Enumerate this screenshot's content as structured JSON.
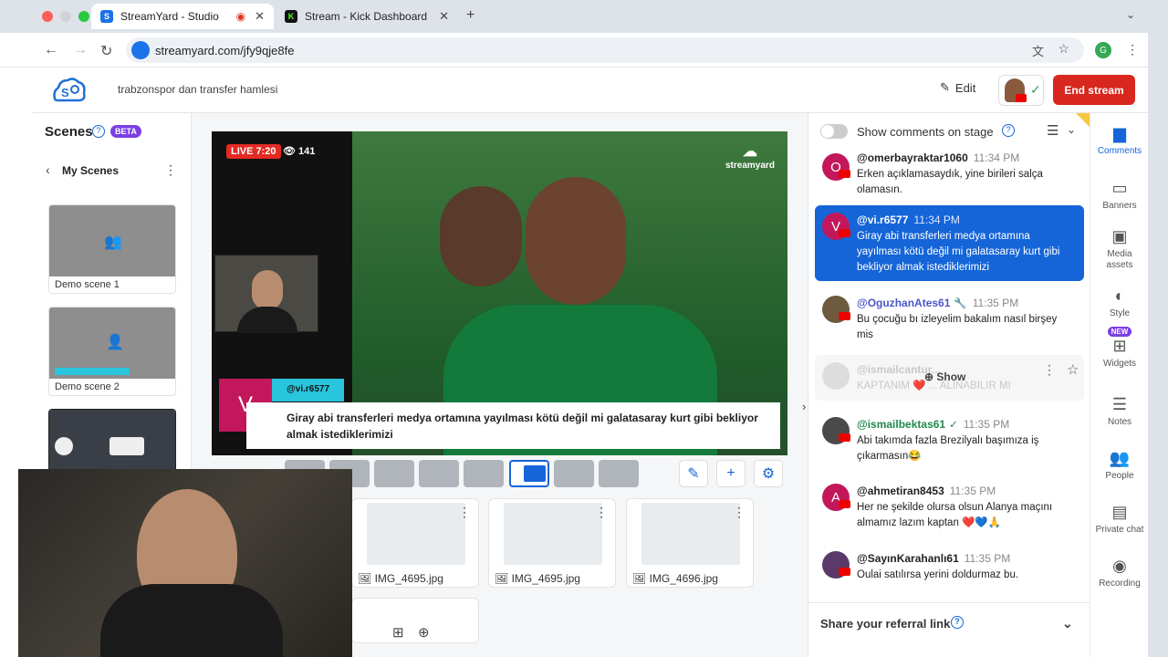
{
  "browser": {
    "tabs": [
      {
        "title": "StreamYard - Studio",
        "active": true
      },
      {
        "title": "Stream - Kick Dashboard",
        "active": false
      }
    ],
    "url": "streamyard.com/jfy9qje8fe",
    "profile_initial": "G"
  },
  "header": {
    "broadcast_title": "trabzonspor dan transfer hamlesi",
    "edit_label": "Edit",
    "end_stream_label": "End stream"
  },
  "scenes": {
    "title": "Scenes",
    "beta": "BETA",
    "my_scenes": "My Scenes",
    "items": [
      {
        "label": "Demo scene 1"
      },
      {
        "label": "Demo scene 2"
      }
    ]
  },
  "stage": {
    "live_label": "LIVE 7:20",
    "viewers": "141",
    "watermark": "streamyard",
    "banner": {
      "avatar_initial": "V",
      "user": "@vi.r6577",
      "text": "Giray abi transferleri medya ortamına yayılması kötü değil mi galatasaray kurt gibi bekliyor almak istediklerimizi"
    }
  },
  "media": {
    "items": [
      {
        "label": "IMG_4695.jpg"
      },
      {
        "label": "IMG_4695.jpg"
      },
      {
        "label": "IMG_4696.jpg"
      }
    ]
  },
  "comments": {
    "toggle_label": "Show comments on stage",
    "items": [
      {
        "initial": "O",
        "color": "#c2185b",
        "user": "@omerbayraktar1060",
        "time": "11:34 PM",
        "text": "Erken açıklamasaydık, yine birileri salça olamasın."
      },
      {
        "initial": "V",
        "color": "#c2185b",
        "user": "@vi.r6577",
        "time": "11:34 PM",
        "text": "Giray abi transferleri medya ortamına yayılması kötü değil mi galatasaray kurt gibi bekliyor almak istediklerimizi"
      },
      {
        "initial": "",
        "color": "#6d5a3f",
        "user": "@OguzhanAtes61",
        "time": "11:35 PM",
        "text": "Bu çocuğu bı izleyelim bakalım nasıl birşey mis"
      },
      {
        "initial": "",
        "color": "#cccccc",
        "user": "@ismailcantur...",
        "time": "",
        "text": "KAPTANIM ❤️ ... ALINABILIR MI",
        "action": "Show"
      },
      {
        "initial": "",
        "color": "#4a4a4a",
        "user": "@ismailbektas61",
        "time": "11:35 PM",
        "text": "Abi takımda fazla Brezilyalı başımıza iş çıkarmasın😂"
      },
      {
        "initial": "A",
        "color": "#c2185b",
        "user": "@ahmetiran8453",
        "time": "11:35 PM",
        "text": "Her ne şekilde olursa olsun Alanya maçını almamız lazım kaptan ❤️💙🙏"
      },
      {
        "initial": "",
        "color": "#5a3a6a",
        "user": "@SayınKarahanlı61",
        "time": "11:35 PM",
        "text": "Oulai satılırsa yerini doldurmaz bu."
      }
    ],
    "referral_label": "Share your referral link"
  },
  "rail": {
    "items": [
      {
        "label": "Comments",
        "icon": "comment-icon"
      },
      {
        "label": "Banners",
        "icon": "banner-icon"
      },
      {
        "label": "Media assets",
        "icon": "media-icon"
      },
      {
        "label": "Style",
        "icon": "palette-icon"
      },
      {
        "label": "Widgets",
        "icon": "widgets-icon",
        "badge": "NEW"
      },
      {
        "label": "Notes",
        "icon": "notes-icon"
      },
      {
        "label": "People",
        "icon": "people-icon"
      },
      {
        "label": "Private chat",
        "icon": "chat-icon"
      },
      {
        "label": "Recording",
        "icon": "record-icon"
      }
    ]
  },
  "colors": {
    "accent": "#1565d8",
    "end_stream": "#d8271e",
    "live": "#e32a23",
    "beta": "#7b3fe4"
  }
}
